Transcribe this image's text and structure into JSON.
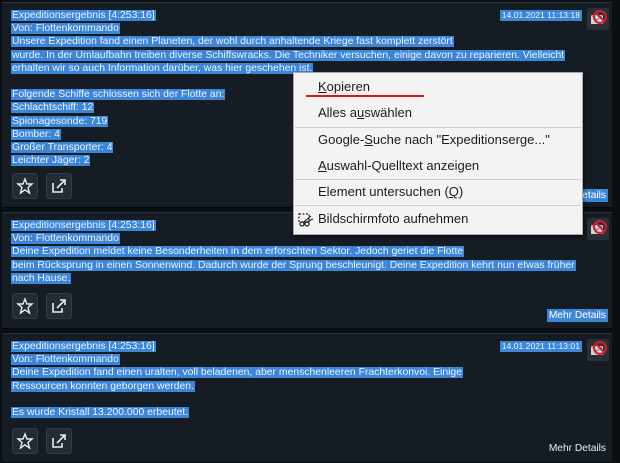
{
  "messages": [
    {
      "lines": [
        "Expeditionsergebnis [4:253:16]",
        "Von: Flottenkommando",
        "Unsere Expedition fand einen Planeten, der wohl durch anhaltende Kriege fast komplett zerstört",
        "wurde. In der Umlaufbahn treiben diverse Schiffswracks. Die Techniker versuchen, einige davon zu reparieren. Vielleicht",
        "erhalten wir so auch Information darüber, was hier geschehen ist.",
        "",
        "Folgende Schiffe schlossen sich der Flotte an:",
        "Schlachtschiff: 12",
        "Spionagesonde: 719",
        "Bomber: 4",
        "Großer Transporter: 4",
        "Leichter Jäger: 2"
      ],
      "date": "14.01.2021 11:13:18",
      "details": "Mehr Details"
    },
    {
      "lines": [
        "Expeditionsergebnis [4:253:16]",
        "Von: Flottenkommando",
        "Deine Expedition meldet keine Besonderheiten in dem erforschten Sektor. Jedoch geriet die Flotte",
        "beim Rücksprung in einen Sonnenwind. Dadurch wurde der Sprung beschleunigt. Deine Expedition kehrt nun etwas früher",
        "nach Hause."
      ],
      "date": "",
      "details": "Mehr Details"
    },
    {
      "lines": [
        "Expeditionsergebnis [4:253:16]",
        "Von: Flottenkommando",
        "Deine Expedition fand einen uralten, voll beladenen, aber menschenleeren Frachterkonvoi. Einige",
        "Ressourcen konnten geborgen werden.",
        "",
        "Es wurde Kristall 13.200.000 erbeutet."
      ],
      "date": "14.01.2021 11:13:01",
      "details": "Mehr Details"
    }
  ],
  "context_menu": {
    "copy": {
      "pre": "",
      "key": "K",
      "post": "opieren"
    },
    "select_all": {
      "pre": "Alles a",
      "key": "u",
      "post": "swählen"
    },
    "google": {
      "pre": "Google-",
      "key": "S",
      "post": "uche nach \"Expeditionserge...\""
    },
    "source": {
      "pre": "",
      "key": "A",
      "post": "uswahl-Quelltext anzeigen"
    },
    "inspect": {
      "pre": "Element untersuchen (",
      "key": "Q",
      "post": ")"
    },
    "screenshot": {
      "pre": "Bildschirmfoto aufnehmen",
      "key": "",
      "post": ""
    }
  },
  "icons": {
    "favorite": "star-icon",
    "share": "share-icon",
    "delete": "delete-message-icon",
    "screenshot": "scissors-screenshot-icon"
  },
  "colors": {
    "selection": "#3d86d6",
    "background": "#161c23",
    "delete_red": "#d21f2a",
    "underline_red": "#e1121b"
  }
}
